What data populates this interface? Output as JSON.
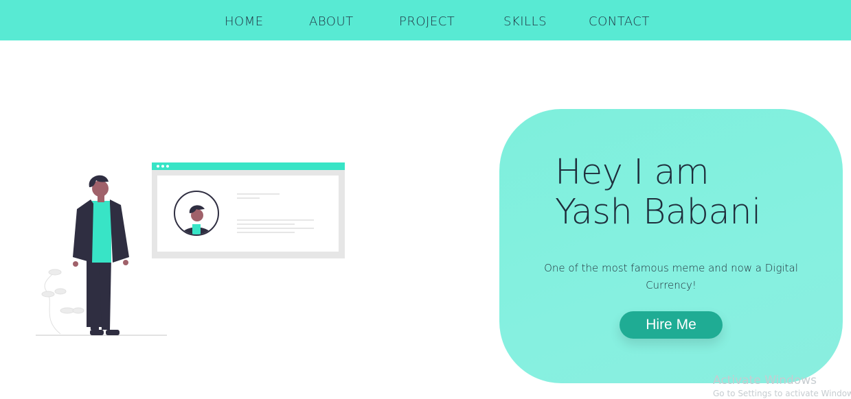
{
  "nav": {
    "items": [
      {
        "label": "HOME"
      },
      {
        "label": "ABOUT"
      },
      {
        "label": "PROJECT"
      },
      {
        "label": "SKILLS"
      },
      {
        "label": "CONTACT"
      }
    ]
  },
  "hero": {
    "title_line1": "Hey I am",
    "title_line2": "Yash Babani",
    "description": "One of the most famous meme and now a Digital Currency!",
    "button_label": "Hire Me"
  },
  "colors": {
    "navbar": "#58ead3",
    "card": "#86f0e0",
    "button": "#1fac94",
    "text_dark": "#1e2d3b"
  },
  "illustration": {
    "icon": "person-profile-illustration"
  },
  "watermark": {
    "title": "Activate Windows",
    "subtitle": "Go to Settings to activate Windows."
  }
}
